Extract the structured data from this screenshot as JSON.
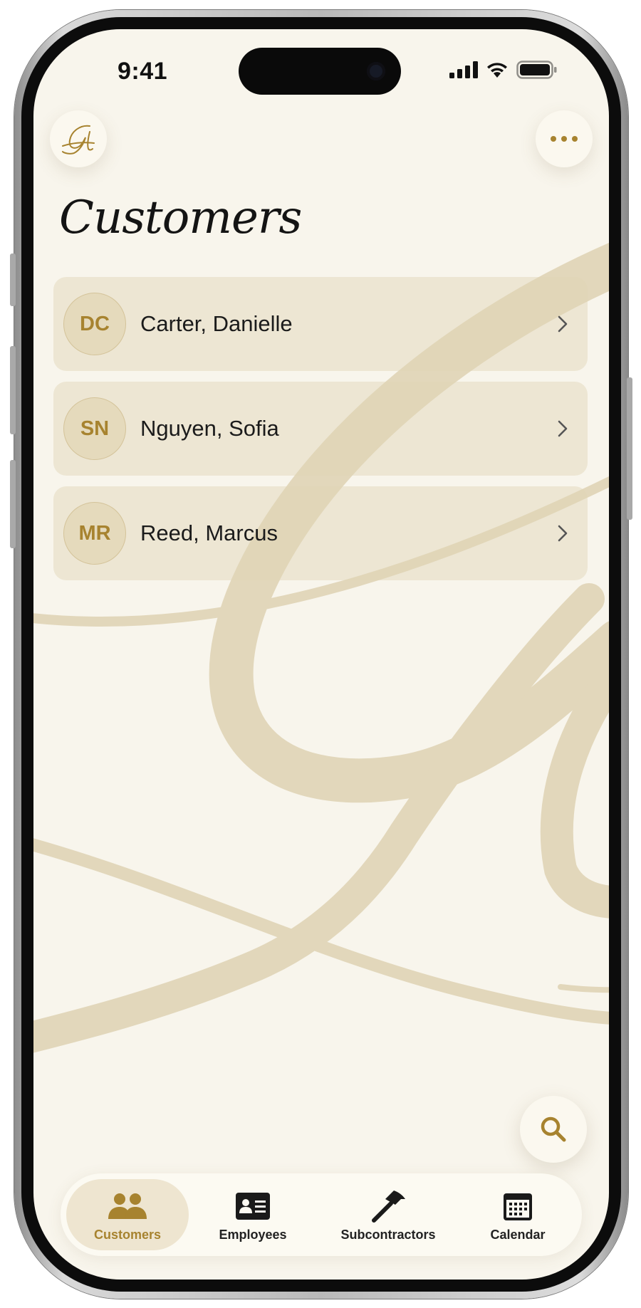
{
  "status_bar": {
    "time": "9:41"
  },
  "header": {
    "logo_text": "Gl",
    "title": "Customers"
  },
  "customers": [
    {
      "initials": "DC",
      "name": "Carter, Danielle"
    },
    {
      "initials": "SN",
      "name": "Nguyen, Sofia"
    },
    {
      "initials": "MR",
      "name": "Reed, Marcus"
    }
  ],
  "tabs": [
    {
      "label": "Customers",
      "icon": "people-icon",
      "active": true
    },
    {
      "label": "Employees",
      "icon": "id-card-icon",
      "active": false
    },
    {
      "label": "Subcontractors",
      "icon": "hammer-icon",
      "active": false
    },
    {
      "label": "Calendar",
      "icon": "calendar-icon",
      "active": false
    }
  ],
  "colors": {
    "accent": "#a7832f",
    "background": "#f8f5ec",
    "row": "#ede4d0",
    "watermark": "#e2d7bb"
  }
}
